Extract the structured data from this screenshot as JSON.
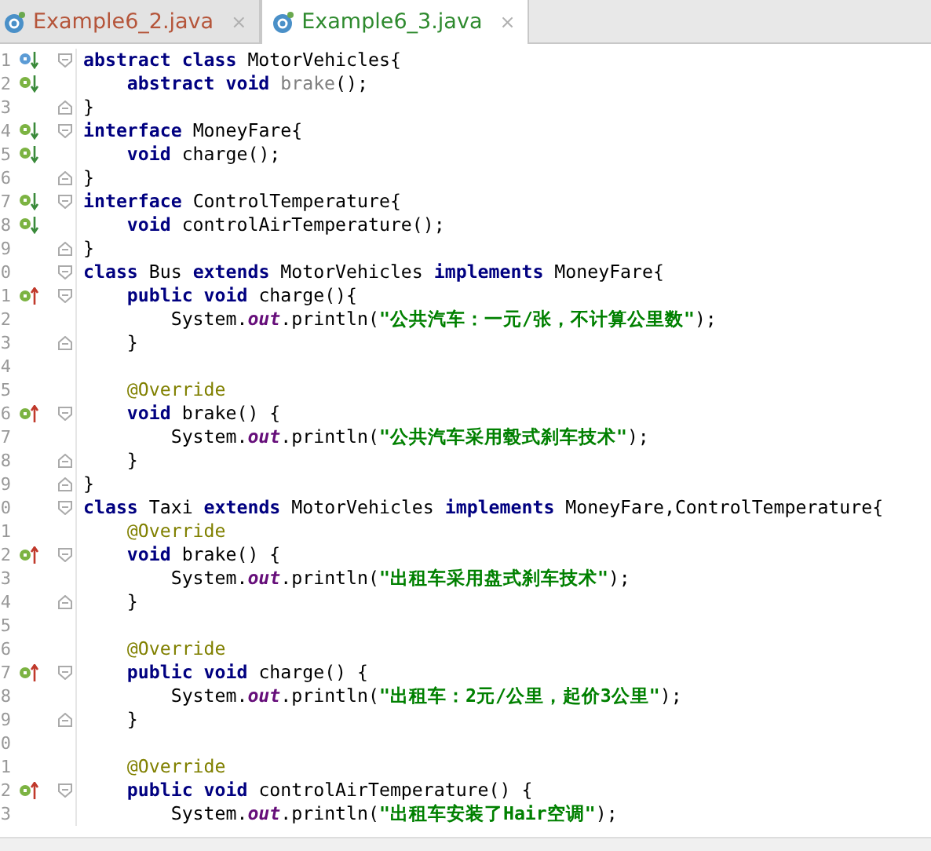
{
  "tabs": [
    {
      "label": "Example6_2.java",
      "close": "×",
      "selected": false,
      "color": "#b5553a"
    },
    {
      "label": "Example6_3.java",
      "close": "×",
      "selected": true,
      "color": "#2e8a2e"
    }
  ],
  "lines": [
    {
      "number": "1",
      "marker": {
        "kind": "class"
      },
      "fold": {
        "kind": "start"
      },
      "tokens": [
        {
          "kind": "keyword",
          "text": "abstract class "
        },
        {
          "kind": "plain",
          "text": "MotorVehicles{"
        }
      ]
    },
    {
      "number": "2",
      "marker": {
        "kind": "implemented"
      },
      "tokens": [
        {
          "kind": "keyword",
          "text": "    abstract void "
        },
        {
          "kind": "unused",
          "text": "brake"
        },
        {
          "kind": "plain",
          "text": "();"
        }
      ]
    },
    {
      "number": "3",
      "fold": {
        "kind": "end"
      },
      "tokens": [
        {
          "kind": "plain",
          "text": "}"
        }
      ]
    },
    {
      "number": "4",
      "marker": {
        "kind": "implemented"
      },
      "fold": {
        "kind": "start"
      },
      "tokens": [
        {
          "kind": "keyword",
          "text": "interface "
        },
        {
          "kind": "plain",
          "text": "MoneyFare{"
        }
      ]
    },
    {
      "number": "5",
      "marker": {
        "kind": "implemented"
      },
      "tokens": [
        {
          "kind": "keyword",
          "text": "    void "
        },
        {
          "kind": "plain",
          "text": "charge();"
        }
      ]
    },
    {
      "number": "6",
      "fold": {
        "kind": "end"
      },
      "tokens": [
        {
          "kind": "plain",
          "text": "}"
        }
      ]
    },
    {
      "number": "7",
      "marker": {
        "kind": "implemented"
      },
      "fold": {
        "kind": "start"
      },
      "tokens": [
        {
          "kind": "keyword",
          "text": "interface "
        },
        {
          "kind": "plain",
          "text": "ControlTemperature{"
        }
      ]
    },
    {
      "number": "8",
      "marker": {
        "kind": "implemented"
      },
      "tokens": [
        {
          "kind": "keyword",
          "text": "    void "
        },
        {
          "kind": "plain",
          "text": "controlAirTemperature();"
        }
      ]
    },
    {
      "number": "9",
      "fold": {
        "kind": "end"
      },
      "tokens": [
        {
          "kind": "plain",
          "text": "}"
        }
      ]
    },
    {
      "number": "0",
      "fold": {
        "kind": "start"
      },
      "tokens": [
        {
          "kind": "keyword",
          "text": "class "
        },
        {
          "kind": "plain",
          "text": "Bus "
        },
        {
          "kind": "keyword",
          "text": "extends "
        },
        {
          "kind": "plain",
          "text": "MotorVehicles "
        },
        {
          "kind": "keyword",
          "text": "implements "
        },
        {
          "kind": "plain",
          "text": "MoneyFare{"
        }
      ]
    },
    {
      "number": "1",
      "marker": {
        "kind": "override"
      },
      "fold": {
        "kind": "start"
      },
      "tokens": [
        {
          "kind": "keyword",
          "text": "    public void "
        },
        {
          "kind": "plain",
          "text": "charge(){"
        }
      ]
    },
    {
      "number": "2",
      "tokens": [
        {
          "kind": "plain",
          "text": "        System."
        },
        {
          "kind": "field",
          "text": "out"
        },
        {
          "kind": "plain",
          "text": ".println("
        },
        {
          "kind": "string",
          "text": "\"公共汽车：一元/张，不计算公里数\""
        },
        {
          "kind": "plain",
          "text": ");"
        }
      ]
    },
    {
      "number": "3",
      "fold": {
        "kind": "end"
      },
      "tokens": [
        {
          "kind": "plain",
          "text": "    }"
        }
      ]
    },
    {
      "number": "4"
    },
    {
      "number": "5",
      "tokens": [
        {
          "kind": "annotation",
          "text": "    @Override"
        }
      ]
    },
    {
      "number": "6",
      "marker": {
        "kind": "override"
      },
      "fold": {
        "kind": "start"
      },
      "tokens": [
        {
          "kind": "keyword",
          "text": "    void "
        },
        {
          "kind": "plain",
          "text": "brake() {"
        }
      ]
    },
    {
      "number": "7",
      "tokens": [
        {
          "kind": "plain",
          "text": "        System."
        },
        {
          "kind": "field",
          "text": "out"
        },
        {
          "kind": "plain",
          "text": ".println("
        },
        {
          "kind": "string",
          "text": "\"公共汽车采用毂式刹车技术\""
        },
        {
          "kind": "plain",
          "text": ");"
        }
      ]
    },
    {
      "number": "8",
      "fold": {
        "kind": "end"
      },
      "tokens": [
        {
          "kind": "plain",
          "text": "    }"
        }
      ]
    },
    {
      "number": "9",
      "fold": {
        "kind": "end"
      },
      "tokens": [
        {
          "kind": "plain",
          "text": "}"
        }
      ]
    },
    {
      "number": "0",
      "fold": {
        "kind": "start"
      },
      "tokens": [
        {
          "kind": "keyword",
          "text": "class "
        },
        {
          "kind": "plain",
          "text": "Taxi "
        },
        {
          "kind": "keyword",
          "text": "extends "
        },
        {
          "kind": "plain",
          "text": "MotorVehicles "
        },
        {
          "kind": "keyword",
          "text": "implements "
        },
        {
          "kind": "plain",
          "text": "MoneyFare,ControlTemperature{"
        }
      ]
    },
    {
      "number": "1",
      "tokens": [
        {
          "kind": "annotation",
          "text": "    @Override"
        }
      ]
    },
    {
      "number": "2",
      "marker": {
        "kind": "override"
      },
      "fold": {
        "kind": "start"
      },
      "tokens": [
        {
          "kind": "keyword",
          "text": "    void "
        },
        {
          "kind": "plain",
          "text": "brake() {"
        }
      ]
    },
    {
      "number": "3",
      "tokens": [
        {
          "kind": "plain",
          "text": "        System."
        },
        {
          "kind": "field",
          "text": "out"
        },
        {
          "kind": "plain",
          "text": ".println("
        },
        {
          "kind": "string",
          "text": "\"出租车采用盘式刹车技术\""
        },
        {
          "kind": "plain",
          "text": ");"
        }
      ]
    },
    {
      "number": "4",
      "fold": {
        "kind": "end"
      },
      "tokens": [
        {
          "kind": "plain",
          "text": "    }"
        }
      ]
    },
    {
      "number": "5"
    },
    {
      "number": "6",
      "tokens": [
        {
          "kind": "annotation",
          "text": "    @Override"
        }
      ]
    },
    {
      "number": "7",
      "marker": {
        "kind": "override"
      },
      "fold": {
        "kind": "start"
      },
      "tokens": [
        {
          "kind": "keyword",
          "text": "    public void "
        },
        {
          "kind": "plain",
          "text": "charge() {"
        }
      ]
    },
    {
      "number": "8",
      "tokens": [
        {
          "kind": "plain",
          "text": "        System."
        },
        {
          "kind": "field",
          "text": "out"
        },
        {
          "kind": "plain",
          "text": ".println("
        },
        {
          "kind": "string",
          "text": "\"出租车：2元/公里，起价3公里\""
        },
        {
          "kind": "plain",
          "text": ");"
        }
      ]
    },
    {
      "number": "9",
      "fold": {
        "kind": "end"
      },
      "tokens": [
        {
          "kind": "plain",
          "text": "    }"
        }
      ]
    },
    {
      "number": "0"
    },
    {
      "number": "1",
      "tokens": [
        {
          "kind": "annotation",
          "text": "    @Override"
        }
      ]
    },
    {
      "number": "2",
      "marker": {
        "kind": "override"
      },
      "fold": {
        "kind": "start"
      },
      "tokens": [
        {
          "kind": "keyword",
          "text": "    public void "
        },
        {
          "kind": "plain",
          "text": "controlAirTemperature() {"
        }
      ]
    },
    {
      "number": "3",
      "tokens": [
        {
          "kind": "plain",
          "text": "        System."
        },
        {
          "kind": "field",
          "text": "out"
        },
        {
          "kind": "plain",
          "text": ".println("
        },
        {
          "kind": "string",
          "text": "\"出租车安装了Hair空调\""
        },
        {
          "kind": "plain",
          "text": ");"
        }
      ]
    }
  ]
}
